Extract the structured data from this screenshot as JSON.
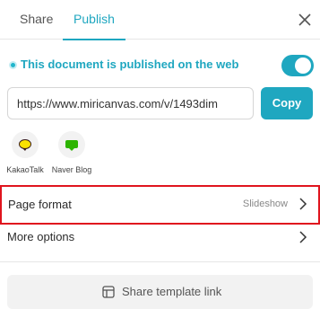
{
  "tabs": [
    {
      "label": "Share",
      "active": false
    },
    {
      "label": "Publish",
      "active": true
    }
  ],
  "publish": {
    "status_text": "This document is published on the web",
    "toggle_on": true
  },
  "url": {
    "value": "https://www.miricanvas.com/v/1493dim"
  },
  "copy_button": {
    "label": "Copy"
  },
  "share_apps": [
    {
      "label": "KakaoTalk",
      "icon": "kakaotalk-icon"
    },
    {
      "label": "Naver Blog",
      "icon": "naver-blog-icon"
    }
  ],
  "page_format": {
    "label": "Page format",
    "value": "Slideshow"
  },
  "more_options": {
    "label": "More options"
  },
  "template_button": {
    "label": "Share template link",
    "icon": "template-icon"
  },
  "colors": {
    "accent": "#1fa7c0",
    "highlight_border": "#e0141e"
  }
}
